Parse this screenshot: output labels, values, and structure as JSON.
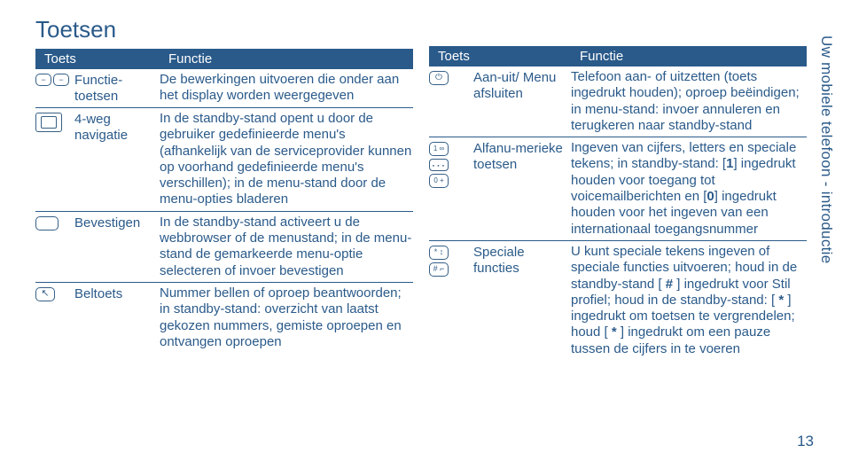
{
  "title": "Toetsen",
  "header": {
    "key_col": "Toets",
    "func_col": "Functie"
  },
  "side_tab": "Uw mobiele telefoon - introductie",
  "page_number": "13",
  "left_rows": [
    {
      "label": "Functie-toetsen",
      "func": "De bewerkingen uitvoeren die onder aan het display worden weergegeven"
    },
    {
      "label": "4-weg navigatie",
      "func": "In de standby-stand opent u door de gebruiker gedefinieerde menu's (afhankelijk van de serviceprovider kunnen op voorhand gedefinieerde menu's verschillen); in de menu-stand door de menu-opties bladeren"
    },
    {
      "label": "Bevestigen",
      "func": "In de standby-stand activeert u de webbrowser of de menustand; in de menu-stand de gemarkeerde menu-optie selecteren of invoer bevestigen"
    },
    {
      "label": "Beltoets",
      "func": "Nummer bellen of oproep beantwoorden; in standby-stand: overzicht van laatst gekozen nummers, gemiste oproepen en ontvangen oproepen"
    }
  ],
  "right_rows": [
    {
      "label": "Aan-uit/ Menu afsluiten",
      "func": "Telefoon aan- of uitzetten (toets ingedrukt houden); oproep beëindigen; in menu-stand: invoer annuleren en terugkeren naar standby-stand"
    },
    {
      "label": "Alfanu-merieke toetsen",
      "func_html": "Ingeven van cijfers, letters en speciale tekens; in standby-stand: [<b>1</b>] ingedrukt houden voor toegang tot voicemailberichten en [<b>0</b>] ingedrukt houden voor het ingeven van een internationaal toegangsnummer"
    },
    {
      "label": "Speciale functies",
      "func_html": "U kunt speciale tekens ingeven of speciale functies uitvoeren; houd in de standby-stand [&nbsp;<b>#</b>&nbsp;] ingedrukt voor Stil profiel; houd in de standby-stand: [&nbsp;<b>*</b>&nbsp;] ingedrukt om toetsen te vergrendelen; houd [&nbsp;<b>*</b>&nbsp;] ingedrukt om een pauze tussen de cijfers in te voeren"
    }
  ]
}
